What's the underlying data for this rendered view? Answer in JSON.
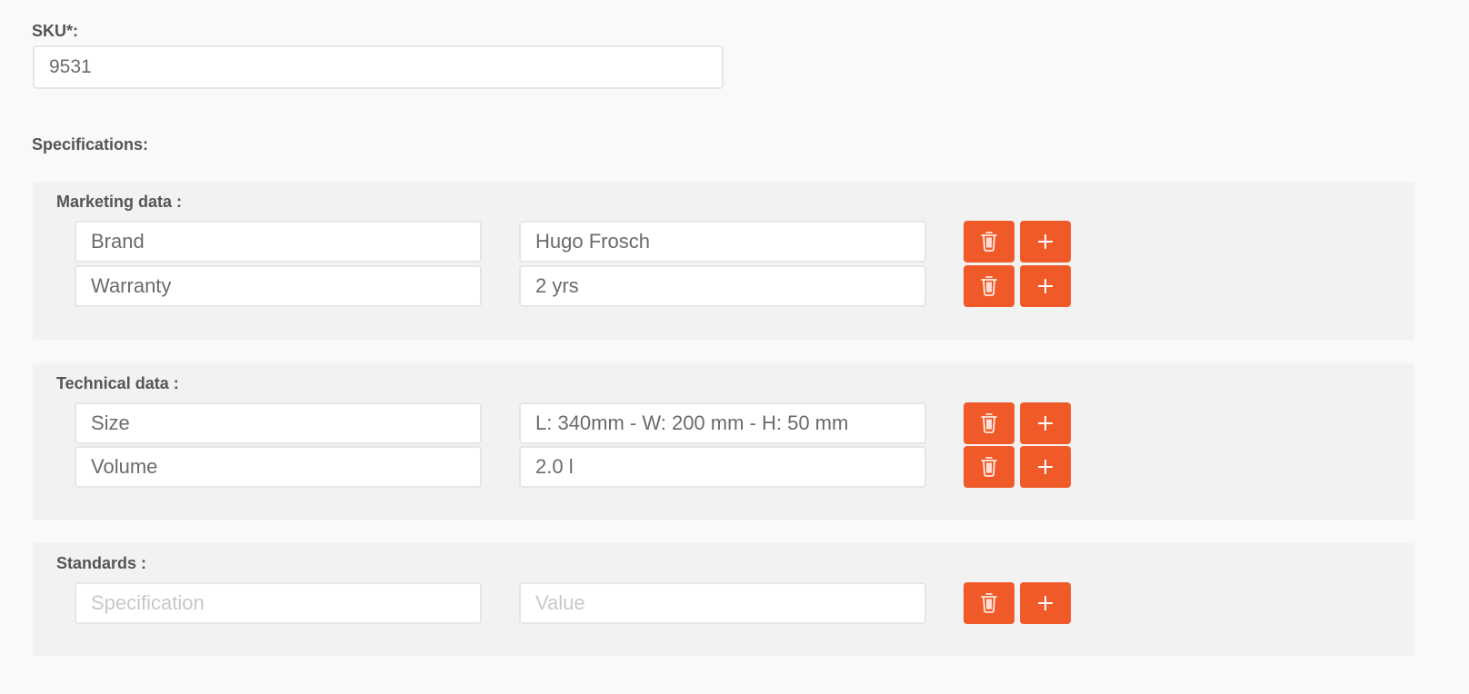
{
  "sku": {
    "label": "SKU*:",
    "value": "9531"
  },
  "specifications_label": "Specifications:",
  "groups": [
    {
      "title": "Marketing data :",
      "rows": [
        {
          "key": "Brand",
          "value": "Hugo Frosch"
        },
        {
          "key": "Warranty",
          "value": "2 yrs"
        }
      ]
    },
    {
      "title": "Technical data :",
      "rows": [
        {
          "key": "Size",
          "value": "L: 340mm - W: 200 mm - H: 50 mm"
        },
        {
          "key": "Volume",
          "value": "2.0 l"
        }
      ]
    },
    {
      "title": "Standards :",
      "rows": [
        {
          "key": "",
          "value": "",
          "key_placeholder": "Specification",
          "value_placeholder": "Value"
        }
      ]
    }
  ],
  "icons": {
    "delete": "trash-icon",
    "add": "plus-icon"
  },
  "colors": {
    "button": "#f05a28",
    "panel": "#f2f2f2",
    "page": "#f9f9f9"
  }
}
